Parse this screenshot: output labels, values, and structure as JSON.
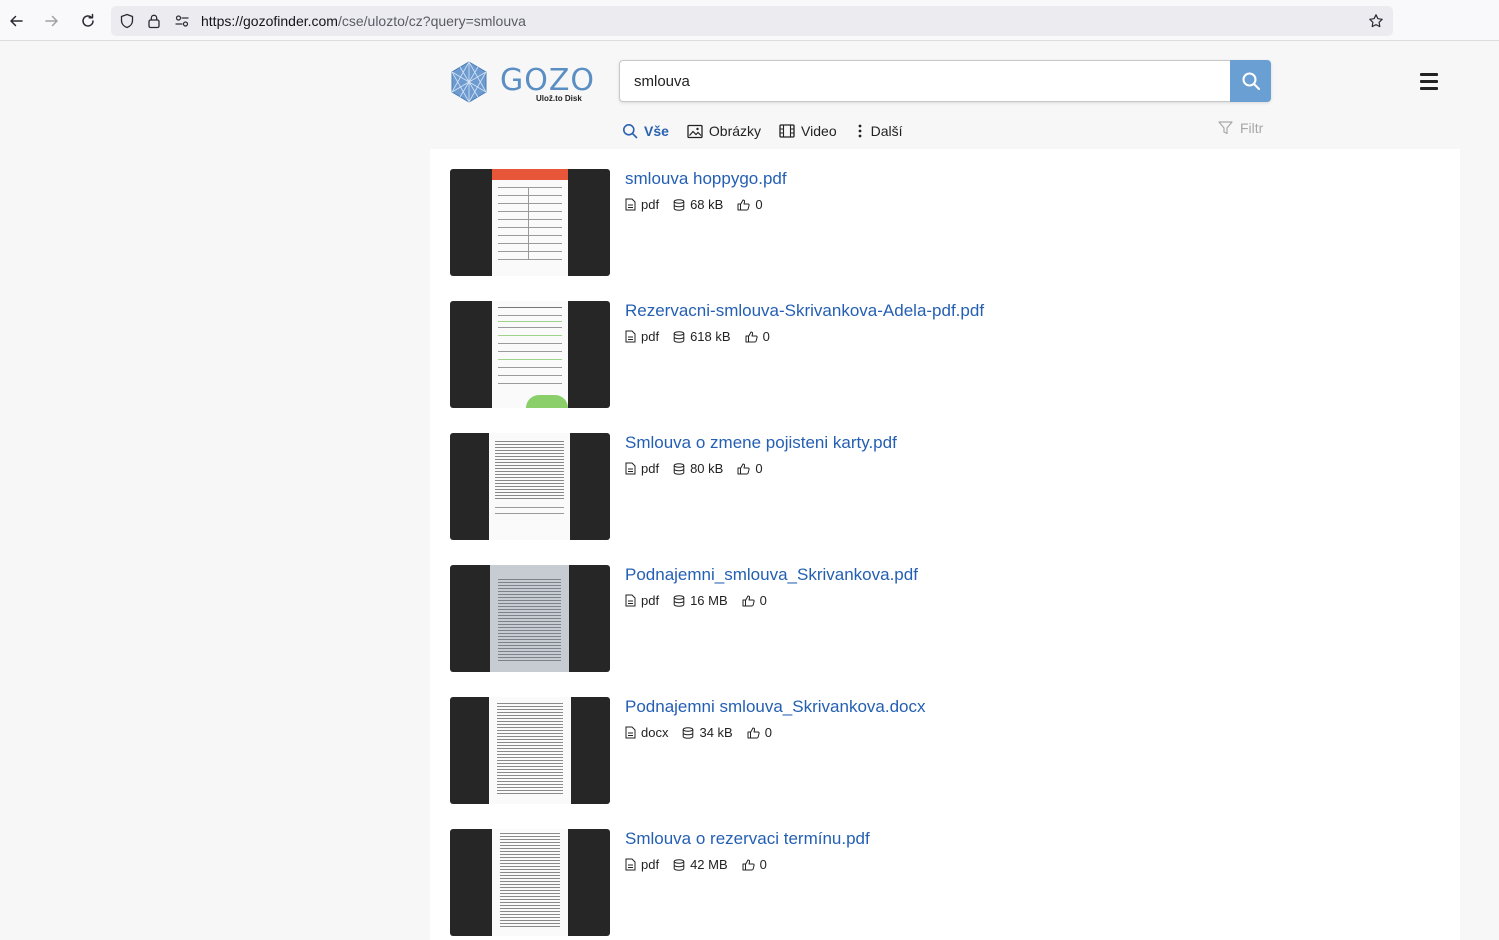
{
  "browser": {
    "url_host": "https://gozofinder.com",
    "url_path": "/cse/ulozto/cz?query=smlouva"
  },
  "header": {
    "logo_word": "GOZO",
    "logo_sub": "Ulož.to Disk",
    "search_value": "smlouva",
    "tabs": [
      {
        "label": "Vše",
        "icon": "search-icon",
        "active": true
      },
      {
        "label": "Obrázky",
        "icon": "image-icon",
        "active": false
      },
      {
        "label": "Video",
        "icon": "film-icon",
        "active": false
      },
      {
        "label": "Další",
        "icon": "more-vertical-icon",
        "active": false
      }
    ],
    "filter_label": "Filtr"
  },
  "results": [
    {
      "title": "smlouva hoppygo.pdf",
      "type": "pdf",
      "size": "68 kB",
      "likes": "0"
    },
    {
      "title": "Rezervacni-smlouva-Skrivankova-Adela-pdf.pdf",
      "type": "pdf",
      "size": "618 kB",
      "likes": "0"
    },
    {
      "title": "Smlouva o zmene pojisteni karty.pdf",
      "type": "pdf",
      "size": "80 kB",
      "likes": "0"
    },
    {
      "title": "Podnajemni_smlouva_Skrivankova.pdf",
      "type": "pdf",
      "size": "16 MB",
      "likes": "0"
    },
    {
      "title": "Podnajemni smlouva_Skrivankova.docx",
      "type": "docx",
      "size": "34 kB",
      "likes": "0"
    },
    {
      "title": "Smlouva o rezervaci termínu.pdf",
      "type": "pdf",
      "size": "42 MB",
      "likes": "0"
    }
  ],
  "colors": {
    "accent": "#245fb3",
    "search_button": "#6a9fd4",
    "logo": "#5b8fc4"
  }
}
